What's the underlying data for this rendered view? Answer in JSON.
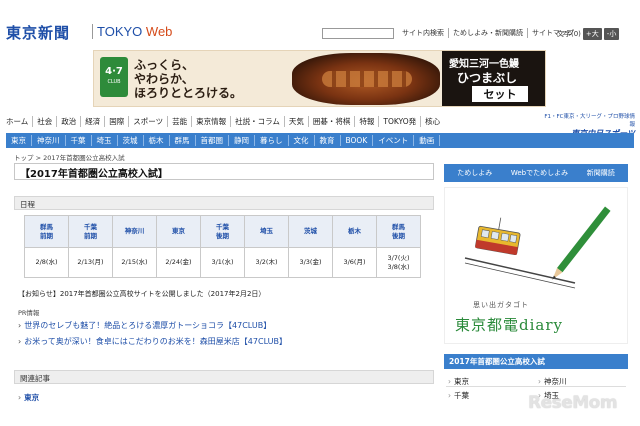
{
  "header": {
    "logo_jp": "東京新聞",
    "logo_en": "TOKYO",
    "logo_en_web": "Web",
    "links": [
      "サイト内検索",
      "ためしよみ・新聞購読",
      "サイトマップ"
    ],
    "fontsize_label": "文字(0)",
    "fontsize_plus": "+大",
    "fontsize_minus": "-小"
  },
  "banner": {
    "logo_main": "4·7",
    "logo_sub": "CLUB",
    "copy_line1": "ふっくら、",
    "copy_line2": "やわらか、",
    "copy_line3": "ほろりととろける。",
    "right_line1": "愛知三河一色鰻",
    "right_line2": "ひつまぶし",
    "right_line3": "セット"
  },
  "nav_primary": [
    "ホーム",
    "社会",
    "政治",
    "経済",
    "国際",
    "スポーツ",
    "芸能",
    "東京情報",
    "社説・コラム",
    "天気",
    "囲碁・将棋",
    "特報",
    "TOKYO発",
    "核心"
  ],
  "chunichi": {
    "line1": "F1・FC東京・大リーグ・プロ野球情報",
    "line2": "東京中日スポーツ"
  },
  "nav_secondary": [
    "東京",
    "神奈川",
    "千葉",
    "埼玉",
    "茨城",
    "栃木",
    "群馬",
    "首都圏",
    "静岡",
    "暮らし",
    "文化",
    "教育",
    "BOOK",
    "イベント",
    "動画"
  ],
  "breadcrumb": "トップ > 2017年首都圏公立高校入試",
  "page_title": "【2017年首都圏公立高校入試】",
  "schedule": {
    "heading": "日程",
    "headers": [
      [
        "群馬",
        "前期"
      ],
      [
        "千葉",
        "前期"
      ],
      [
        "神奈川"
      ],
      [
        "東京"
      ],
      [
        "千葉",
        "後期"
      ],
      [
        "埼玉"
      ],
      [
        "茨城"
      ],
      [
        "栃木"
      ],
      [
        "群馬",
        "後期"
      ]
    ],
    "dates": [
      [
        "2/8(水)"
      ],
      [
        "2/13(月)"
      ],
      [
        "2/15(水)"
      ],
      [
        "2/24(金)"
      ],
      [
        "3/1(水)"
      ],
      [
        "3/2(木)"
      ],
      [
        "3/3(金)"
      ],
      [
        "3/6(月)"
      ],
      [
        "3/7(火)",
        "3/8(水)"
      ]
    ]
  },
  "notice": "【お知らせ】2017年首都圏公立高校サイトを公開しました（2017年2月2日）",
  "pr": {
    "label": "PR情報",
    "links": [
      "世界のセレブも魅了！絶品とろける濃厚ガトーショコラ【47CLUB】",
      "お米って奥が深い！食卓にはこだわりのお米を！森田屋米店【47CLUB】"
    ]
  },
  "related": {
    "heading": "関連記事",
    "items": [
      "東京"
    ]
  },
  "sidebar": {
    "buttons": [
      "ためしよみ",
      "Webでためしよみ",
      "新聞購読"
    ],
    "diary_small": "思い出ガタゴト",
    "diary_big": "東京都電diary",
    "section_heading": "2017年首都圏公立高校入試",
    "links": [
      "東京",
      "神奈川",
      "千葉",
      "埼玉"
    ]
  },
  "watermark": "ReseMom"
}
